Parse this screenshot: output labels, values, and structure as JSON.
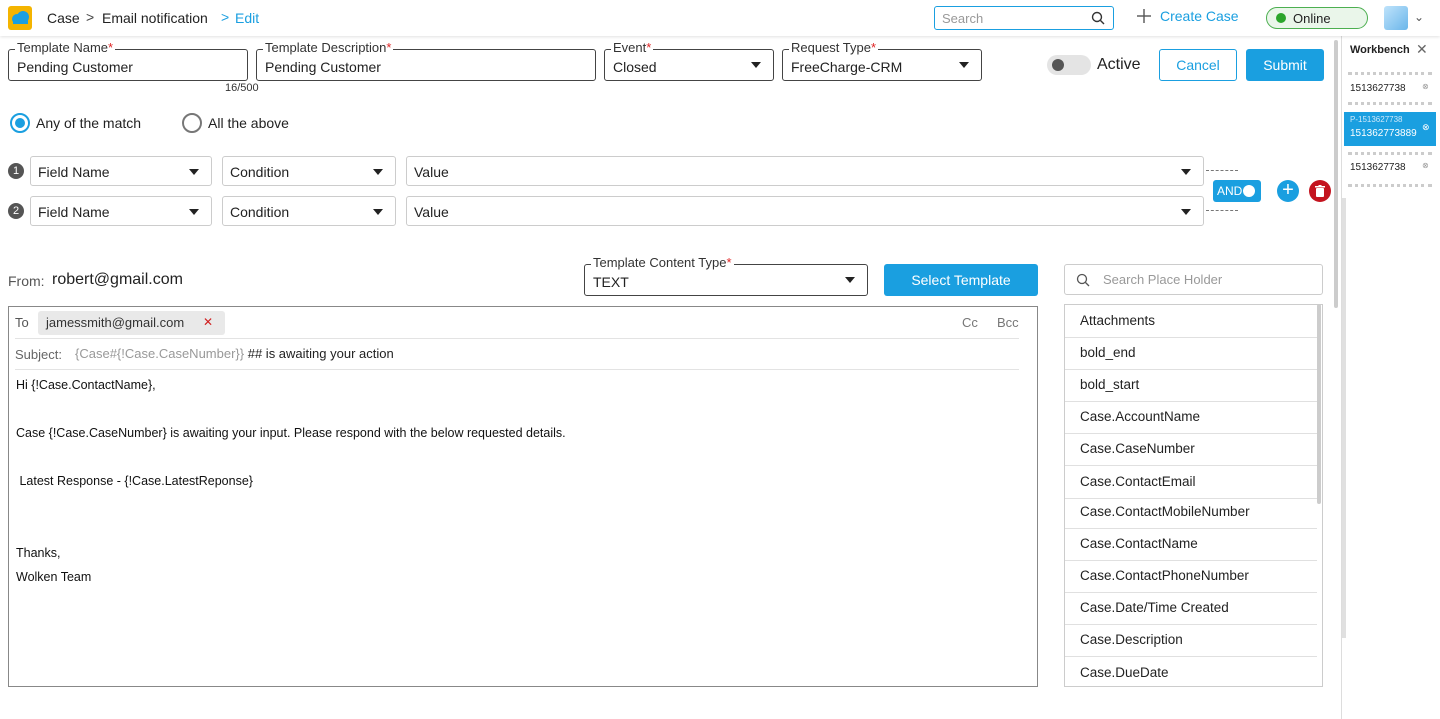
{
  "header": {
    "breadcrumb": [
      "Case",
      ">",
      "Email notification",
      ">",
      "Edit"
    ],
    "search_placeholder": "Search",
    "create_case": "Create Case",
    "status": "Online"
  },
  "form": {
    "template_name": {
      "label": "Template Name",
      "value": "Pending Customer"
    },
    "template_description": {
      "label": "Template Description",
      "value": "Pending Customer"
    },
    "counter": "16/500",
    "event": {
      "label": "Event",
      "value": "Closed"
    },
    "request_type": {
      "label": "Request Type",
      "value": "FreeCharge-CRM"
    },
    "active_label": "Active",
    "cancel": "Cancel",
    "submit": "Submit"
  },
  "match": {
    "any": "Any of the match",
    "all": "All the above",
    "selected": "any"
  },
  "conditions": [
    {
      "num": "1",
      "field": "Field Name",
      "condition": "Condition",
      "value": "Value"
    },
    {
      "num": "2",
      "field": "Field Name",
      "condition": "Condition",
      "value": "Value"
    }
  ],
  "logic_toggle": "AND",
  "email": {
    "from_label": "From:",
    "from": "robert@gmail.com",
    "content_type": {
      "label": "Template Content Type",
      "value": "TEXT"
    },
    "select_template": "Select Template",
    "to_label": "To",
    "to_chip": "jamessmith@gmail.com",
    "cc": "Cc",
    "bcc": "Bcc",
    "subject_label": "Subject:",
    "subject_placeholder": "{Case#{!Case.CaseNumber}}",
    "subject_text": "## is awaiting your action",
    "body": [
      "Hi  {!Case.ContactName},",
      "Case  {!Case.CaseNumber} is awaiting your input. Please respond with the below requested details.",
      " Latest Response - {!Case.LatestReponse}",
      "Thanks,",
      "Wolken Team"
    ]
  },
  "placeholders": {
    "search_placeholder": "Search Place Holder",
    "items": [
      "Attachments",
      "bold_end",
      "bold_start",
      "Case.AccountName",
      "Case.CaseNumber",
      "Case.ContactEmail",
      "Case.ContactMobileNumber",
      "Case.ContactName",
      "Case.ContactPhoneNumber",
      "Case.Date/Time Created",
      "Case.Description",
      "Case.DueDate"
    ]
  },
  "workbench": {
    "title": "Workbench",
    "items": [
      "1513627738",
      "1513627738"
    ],
    "active_sub": "P-1513627738",
    "active": "151362773889"
  },
  "colors": {
    "accent": "#1a9fe0",
    "danger": "#c4141f",
    "online": "#2ca52c"
  }
}
